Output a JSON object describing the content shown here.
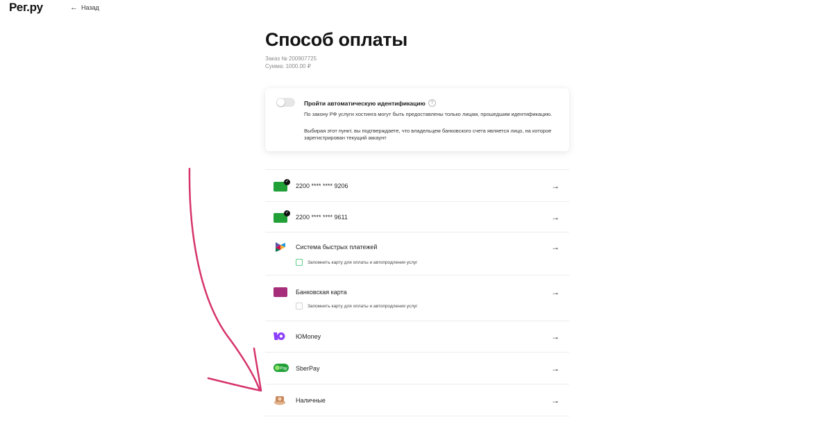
{
  "header": {
    "logo": "Рег.ру",
    "back_label": "Назад"
  },
  "page": {
    "title": "Способ оплаты",
    "order_number": "Заказ № 200907725",
    "amount": "Сумма: 1000.00 ₽"
  },
  "identification": {
    "title": "Пройти автоматическую идентификацию",
    "help": "?",
    "text1": "По закону РФ услуги хостинга могут быть предоставлены только лицам, прошедшим идентификацию.",
    "text2": "Выбирая этот пункт, вы подтверждаете, что владельцем банковского счета является лицо, на которое зарегистрирован текущий аккаунт",
    "enabled": false
  },
  "payment_methods": [
    {
      "label": "2200 **** **** 9206",
      "icon": "saved-card-icon"
    },
    {
      "label": "2200 **** **** 9611",
      "icon": "saved-card-icon"
    },
    {
      "label": "Система быстрых платежей",
      "icon": "sbp-icon",
      "remember": "Запомнить карту для оплаты и автопродления услуг"
    },
    {
      "label": "Банковская карта",
      "icon": "bank-card-icon",
      "remember": "Запомнить карту для оплаты и автопродления услуг"
    },
    {
      "label": "ЮMoney",
      "icon": "yoomoney-icon"
    },
    {
      "label": "SberPay",
      "icon": "sberpay-icon",
      "icon_text": "Pay"
    },
    {
      "label": "Наличные",
      "icon": "cash-icon"
    }
  ],
  "colors": {
    "card_green": "#21a038",
    "card_purple": "#a52d7a",
    "yoomoney": "#8b3ffd",
    "annotation_arrow": "#d6336c"
  }
}
